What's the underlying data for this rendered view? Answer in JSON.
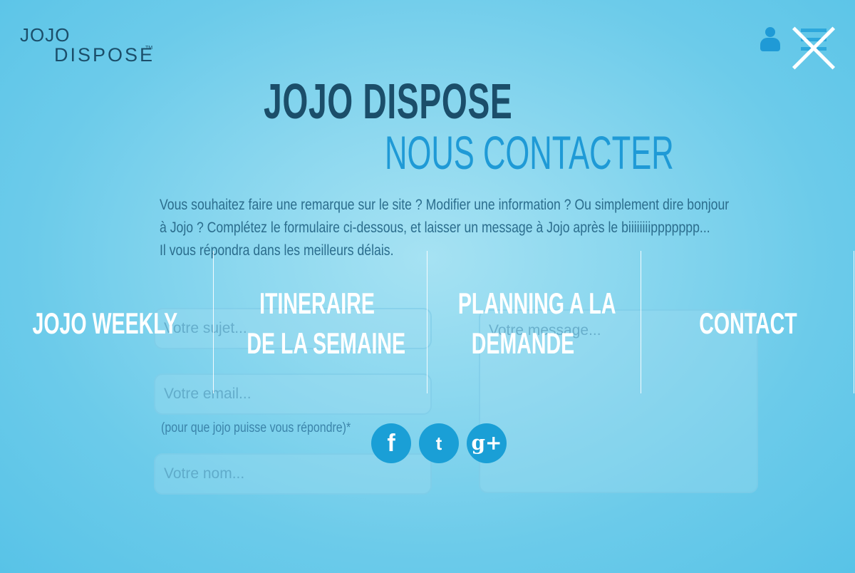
{
  "logo": {
    "line1": "JOJO",
    "line2": "DISPOSE",
    "tm": "TM"
  },
  "title": "JOJO DISPOSE",
  "subtitle": "NOUS CONTACTER",
  "intro": {
    "line1": "Vous souhaitez faire une remarque sur le site ? Modifier une information ? Ou simplement dire bonjour",
    "line2": "à Jojo ? Complétez le formulaire ci-dessous, et laisser un message à Jojo après le biiiiiiiippppppp...",
    "line3": "Il vous répondra dans les meilleurs délais."
  },
  "form": {
    "subject_placeholder": "Votre sujet...",
    "email_placeholder": "Votre email...",
    "email_note": "(pour que jojo puisse vous répondre)*",
    "name_placeholder": "Votre nom...",
    "message_placeholder": "Votre message..."
  },
  "social": {
    "facebook": "f",
    "twitter": "t",
    "googleplus": "g+"
  },
  "nav": {
    "item1": "JOJO WEEKLY",
    "item2_line1": "ITINERAIRE",
    "item2_line2": "DE LA SEMAINE",
    "item3_line1": "PLANNING A LA",
    "item3_line2": "DEMANDE",
    "item4": "CONTACT"
  },
  "colors": {
    "accent": "#1f9ad6",
    "dark": "#1b4e6a",
    "text": "#2b6d8d"
  }
}
